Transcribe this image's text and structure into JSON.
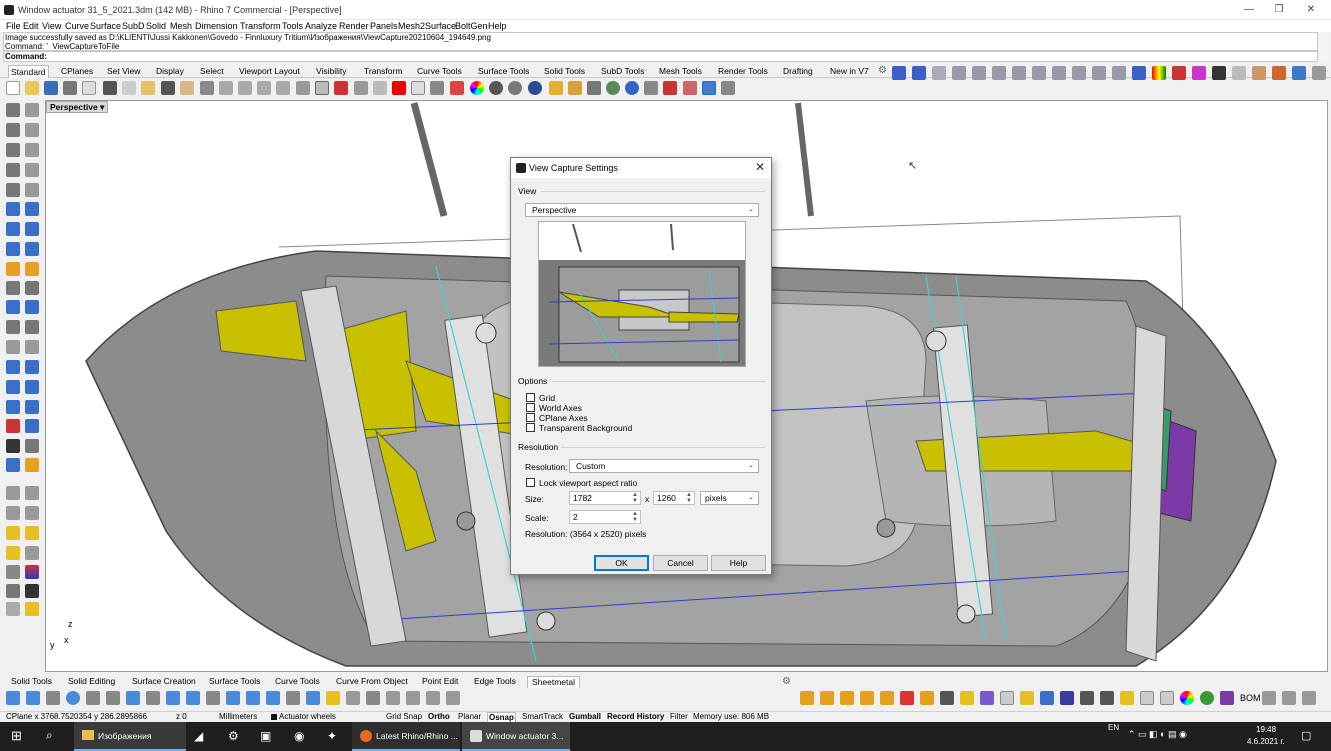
{
  "window": {
    "title": "Window actuator 31_5_2021.3dm (142 MB) - Rhino 7 Commercial - [Perspective]",
    "min": "—",
    "max": "❐",
    "close": "✕"
  },
  "menu": [
    "File",
    "Edit",
    "View",
    "Curve",
    "Surface",
    "SubD",
    "Solid",
    "Mesh",
    "Dimension",
    "Transform",
    "Tools",
    "Analyze",
    "Render",
    "Panels",
    "Mesh2Surface",
    "BoltGen",
    "Help"
  ],
  "command": {
    "history_line1": "Image successfully saved as D:\\KLIENTI\\Jussi Kakkonen\\Govedo - Finnluxury Tritium\\Изображения\\ViewCapture20210604_194649.png",
    "history_line2": "Command: '_ViewCaptureToFile",
    "prompt": "Command:"
  },
  "toolbar_tabs": [
    "Standard",
    "CPlanes",
    "Set View",
    "Display",
    "Select",
    "Viewport Layout",
    "Visibility",
    "Transform",
    "Curve Tools",
    "Surface Tools",
    "Solid Tools",
    "SubD Tools",
    "Mesh Tools",
    "Render Tools",
    "Drafting",
    "New in V7"
  ],
  "viewport": {
    "label": "Perspective",
    "axis_x": "x",
    "axis_y": "y",
    "axis_z": "z"
  },
  "dialog": {
    "title": "View Capture Settings",
    "view_section": "View",
    "view_value": "Perspective",
    "options_section": "Options",
    "options": [
      "Grid",
      "World Axes",
      "CPlane Axes",
      "Transparent Background"
    ],
    "resolution_section": "Resolution",
    "resolution_label": "Resolution:",
    "resolution_value": "Custom",
    "lock_label": "Lock viewport aspect ratio",
    "size_label": "Size:",
    "width": "1782",
    "x_sep": "x",
    "height": "1260",
    "units": "pixels",
    "scale_label": "Scale:",
    "scale": "2",
    "result": "Resolution: (3564 x 2520) pixels",
    "ok": "OK",
    "cancel": "Cancel",
    "help": "Help"
  },
  "bottom_tabs": [
    "Solid Tools",
    "Solid Editing",
    "Surface Creation",
    "Surface Tools",
    "Curve Tools",
    "Curve From Object",
    "Point Edit",
    "Edge Tools",
    "Sheetmetal"
  ],
  "bottom_bom": "BOM",
  "status": {
    "coords": "CPlane  x 3768.7520354  y 286.2895866",
    "z": "z 0",
    "units": "Millimeters",
    "layer": "Actuator wheels",
    "grid_snap": "Grid Snap",
    "ortho": "Ortho",
    "planar": "Planar",
    "osnap": "Osnap",
    "smarttrack": "SmartTrack",
    "gumball": "Gumball",
    "record_history": "Record History",
    "filter": "Filter",
    "memory": "Memory use: 806 MB"
  },
  "taskbar": {
    "explorer": "Изображения",
    "firefox": "Latest Rhino/Rhino ...",
    "rhino": "Window actuator 3...",
    "lang": "EN",
    "time": "19:48",
    "date": "4.6.2021 г."
  },
  "colors": {
    "accent": "#0078d7",
    "model_yellow": "#c8c000",
    "model_grey": "#8a8a8a",
    "taskbar": "#1f1f1f"
  }
}
